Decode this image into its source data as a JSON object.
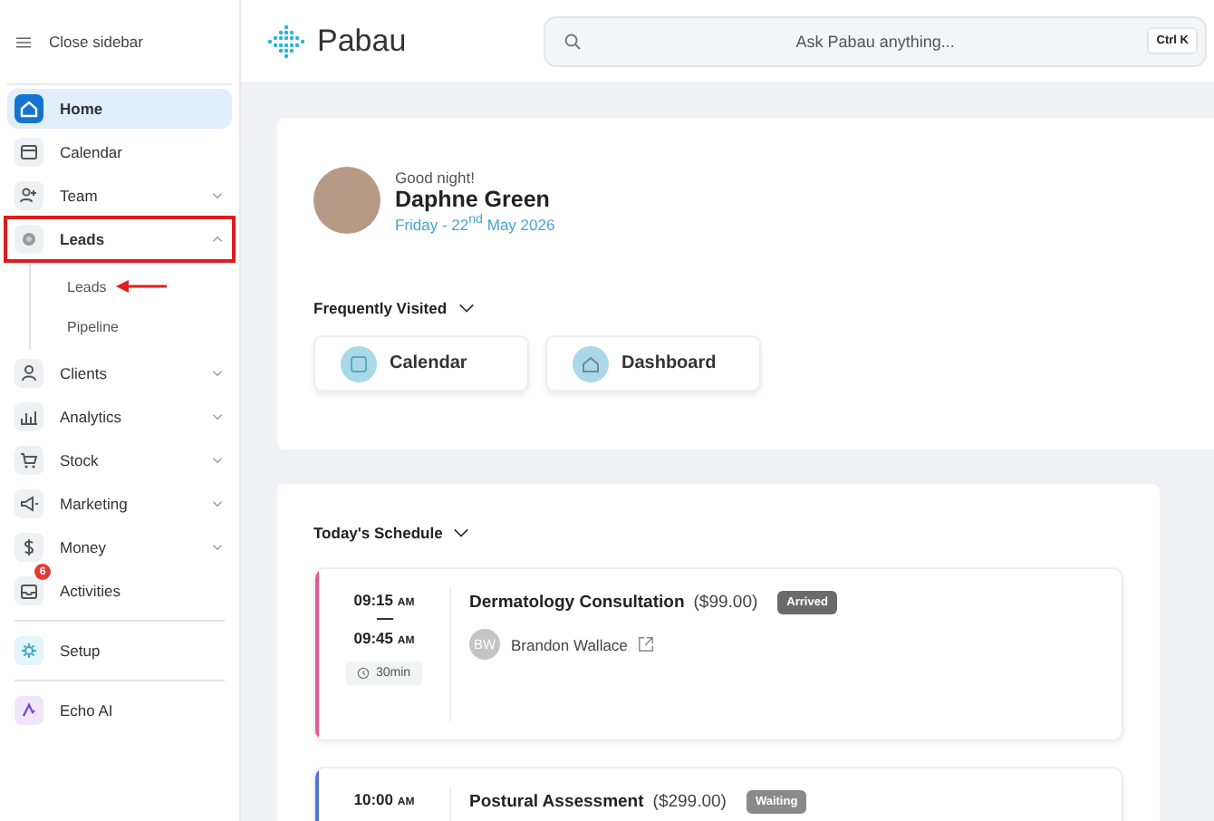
{
  "sidebar": {
    "toggle_label": "Close sidebar",
    "groups": [
      [
        {
          "label": "Home",
          "selected": true,
          "expandable": false,
          "expanded": false,
          "highlighted": false
        },
        {
          "label": "Calendar",
          "selected": false,
          "expandable": false,
          "expanded": false,
          "highlighted": false
        },
        {
          "label": "Team",
          "selected": false,
          "expandable": true,
          "expanded": false,
          "highlighted": false
        },
        {
          "label": "Leads",
          "selected": false,
          "expandable": true,
          "expanded": true,
          "highlighted": true,
          "children": [
            {
              "label": "Leads",
              "pointed": true
            },
            {
              "label": "Pipeline",
              "pointed": false
            }
          ]
        },
        {
          "label": "Clients",
          "selected": false,
          "expandable": true,
          "expanded": false,
          "highlighted": false
        },
        {
          "label": "Analytics",
          "selected": false,
          "expandable": true,
          "expanded": false,
          "highlighted": false
        },
        {
          "label": "Stock",
          "selected": false,
          "expandable": true,
          "expanded": false,
          "highlighted": false
        },
        {
          "label": "Marketing",
          "selected": false,
          "expandable": true,
          "expanded": false,
          "highlighted": false
        },
        {
          "label": "Money",
          "selected": false,
          "expandable": true,
          "expanded": false,
          "highlighted": false
        },
        {
          "label": "Activities",
          "selected": false,
          "expandable": false,
          "expanded": false,
          "highlighted": false,
          "badge": "6"
        }
      ],
      [
        {
          "label": "Setup",
          "selected": false,
          "expandable": false,
          "expanded": false,
          "highlighted": false
        }
      ],
      [
        {
          "label": "Echo AI",
          "selected": false,
          "expandable": false,
          "expanded": false,
          "highlighted": false
        }
      ]
    ]
  },
  "header": {
    "logo": "Pabau",
    "search": {
      "placeholder": "Ask Pabau anything...",
      "shortcut": "Ctrl K"
    }
  },
  "welcome": {
    "greeting": "Good night!",
    "name": "Daphne Green",
    "date": "Friday - 22$^{nd}$ May 2026",
    "frequently_visited": {
      "title": "Frequently Visited",
      "items": [
        {
          "label": "Calendar"
        },
        {
          "label": "Dashboard"
        }
      ]
    }
  },
  "schedule": {
    "title": "Today's Schedule",
    "appointments": [
      {
        "start": "09:15",
        "start_suffix": "AM",
        "end": "09:45",
        "end_suffix": "AM",
        "duration": "30min",
        "service": "Dermatology Consultation",
        "price": "($99.00)",
        "status": "Arrived",
        "kind": "arrived",
        "client_initials": "BW",
        "client": "Brandon Wallace",
        "color": "#e8578f"
      },
      {
        "start": "10:00",
        "start_suffix": "AM",
        "service": "Postural Assessment",
        "price": "($299.00)",
        "status": "Waiting",
        "kind": "waiting",
        "color": "#4f74e0"
      }
    ]
  }
}
